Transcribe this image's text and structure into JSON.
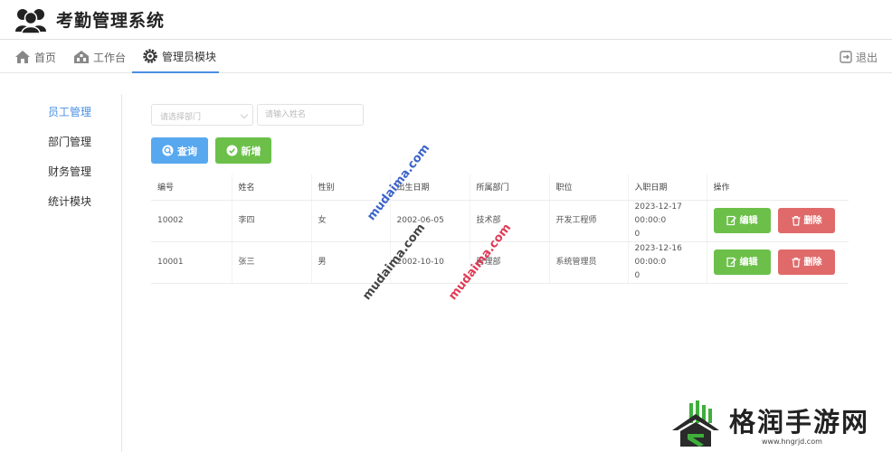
{
  "app": {
    "title": "考勤管理系统"
  },
  "nav": {
    "items": [
      {
        "label": "首页",
        "icon": "home-icon"
      },
      {
        "label": "工作台",
        "icon": "workbench-icon"
      },
      {
        "label": "管理员模块",
        "icon": "gear-icon",
        "active": true
      }
    ],
    "logout_label": "退出"
  },
  "sidebar": {
    "items": [
      {
        "label": "员工管理",
        "active": true
      },
      {
        "label": "部门管理"
      },
      {
        "label": "财务管理"
      },
      {
        "label": "统计模块"
      }
    ]
  },
  "filters": {
    "department_placeholder": "请选择部门",
    "name_placeholder": "请输入姓名",
    "query_label": "查询",
    "add_label": "新增"
  },
  "table": {
    "headers": [
      "编号",
      "姓名",
      "性别",
      "出生日期",
      "所属部门",
      "职位",
      "入职日期",
      "操作"
    ],
    "rows": [
      {
        "id": "10002",
        "name": "李四",
        "gender": "女",
        "birth": "2002-06-05",
        "dept": "技术部",
        "position": "开发工程师",
        "hire_a": "2023-12-17 00:00:0",
        "hire_b": "0"
      },
      {
        "id": "10001",
        "name": "张三",
        "gender": "男",
        "birth": "2002-10-10",
        "dept": "管理部",
        "position": "系统管理员",
        "hire_a": "2023-12-16 00:00:0",
        "hire_b": "0"
      }
    ],
    "edit_label": "编辑",
    "delete_label": "删除"
  },
  "watermarks": [
    "mudaima.com",
    "mudaima.com",
    "mudaima.com"
  ],
  "brand": {
    "name": "格润手游网",
    "url": "www.hngrjd.com"
  },
  "colors": {
    "accent": "#4a90e2",
    "query": "#58a8f0",
    "success": "#6cc04a",
    "danger": "#e06a6a"
  }
}
